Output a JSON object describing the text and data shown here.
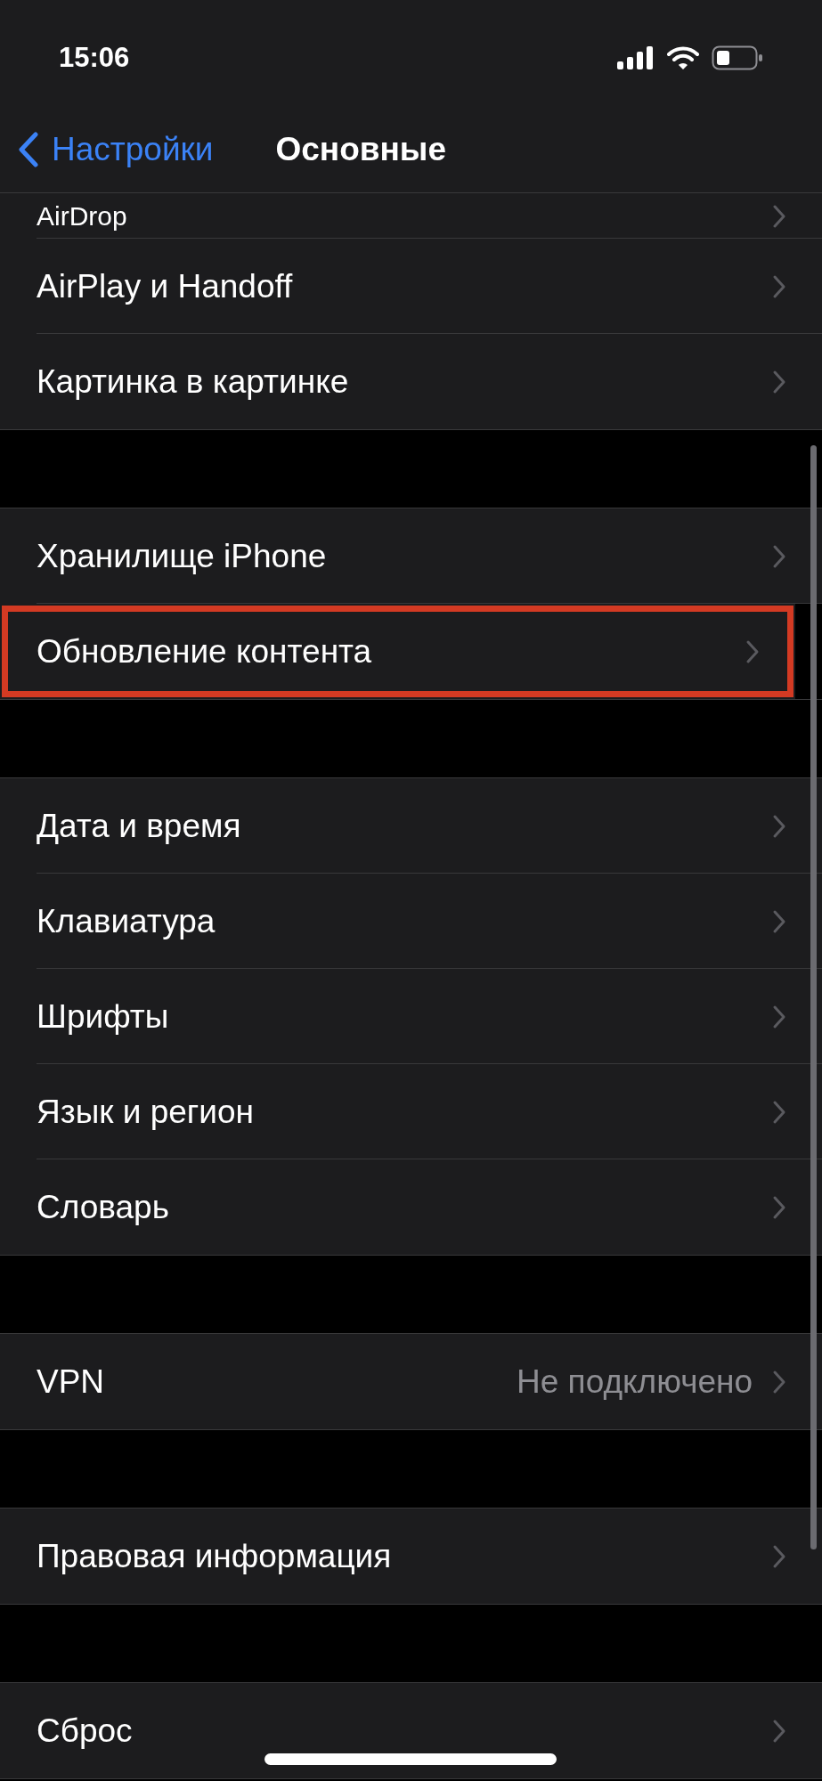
{
  "status_bar": {
    "time": "15:06"
  },
  "nav": {
    "back": "Настройки",
    "title": "Основные"
  },
  "sections": [
    {
      "rows": [
        {
          "label": "AirDrop",
          "partial": true,
          "highlighted": false
        },
        {
          "label": "AirPlay и Handoff",
          "highlighted": false
        },
        {
          "label": "Картинка в картинке",
          "highlighted": false
        }
      ]
    },
    {
      "rows": [
        {
          "label": "Хранилище iPhone",
          "highlighted": false
        },
        {
          "label": "Обновление контента",
          "highlighted": true
        }
      ]
    },
    {
      "rows": [
        {
          "label": "Дата и время",
          "highlighted": false
        },
        {
          "label": "Клавиатура",
          "highlighted": false
        },
        {
          "label": "Шрифты",
          "highlighted": false
        },
        {
          "label": "Язык и регион",
          "highlighted": false
        },
        {
          "label": "Словарь",
          "highlighted": false
        }
      ]
    },
    {
      "rows": [
        {
          "label": "VPN",
          "value": "Не подключено",
          "highlighted": false
        }
      ]
    },
    {
      "rows": [
        {
          "label": "Правовая информация",
          "highlighted": false
        }
      ]
    },
    {
      "rows": [
        {
          "label": "Сброс",
          "highlighted": false
        }
      ]
    }
  ]
}
